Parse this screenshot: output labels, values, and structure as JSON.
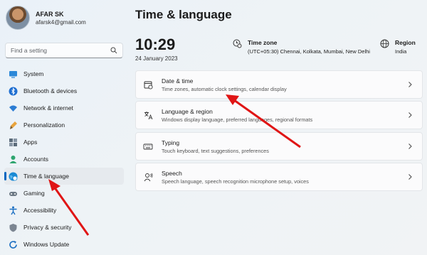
{
  "profile": {
    "name": "AFAR SK",
    "email": "afarsk4@gmail.com"
  },
  "search": {
    "placeholder": "Find a setting"
  },
  "sidebar": {
    "items": [
      {
        "label": "System",
        "icon": "system-icon"
      },
      {
        "label": "Bluetooth & devices",
        "icon": "bluetooth-icon"
      },
      {
        "label": "Network & internet",
        "icon": "wifi-icon"
      },
      {
        "label": "Personalization",
        "icon": "brush-icon"
      },
      {
        "label": "Apps",
        "icon": "apps-icon"
      },
      {
        "label": "Accounts",
        "icon": "accounts-icon"
      },
      {
        "label": "Time & language",
        "icon": "globe-clock-icon",
        "active": true
      },
      {
        "label": "Gaming",
        "icon": "gaming-icon"
      },
      {
        "label": "Accessibility",
        "icon": "accessibility-icon"
      },
      {
        "label": "Privacy & security",
        "icon": "shield-icon"
      },
      {
        "label": "Windows Update",
        "icon": "update-icon"
      }
    ]
  },
  "main": {
    "title": "Time & language",
    "clock": "10:29",
    "date": "24 January 2023",
    "timezone": {
      "title": "Time zone",
      "value": "(UTC+05:30) Chennai, Kolkata, Mumbai, New Delhi"
    },
    "region": {
      "title": "Region",
      "value": "India"
    },
    "cards": [
      {
        "title": "Date & time",
        "desc": "Time zones, automatic clock settings, calendar display",
        "icon": "calendar-clock-icon"
      },
      {
        "title": "Language & region",
        "desc": "Windows display language, preferred languages, regional formats",
        "icon": "language-icon"
      },
      {
        "title": "Typing",
        "desc": "Touch keyboard, text suggestions, preferences",
        "icon": "keyboard-icon"
      },
      {
        "title": "Speech",
        "desc": "Speech language, speech recognition microphone setup, voices",
        "icon": "speech-icon"
      }
    ]
  },
  "colors": {
    "accent": "#0067c0",
    "annotation_arrow": "#e01515"
  }
}
